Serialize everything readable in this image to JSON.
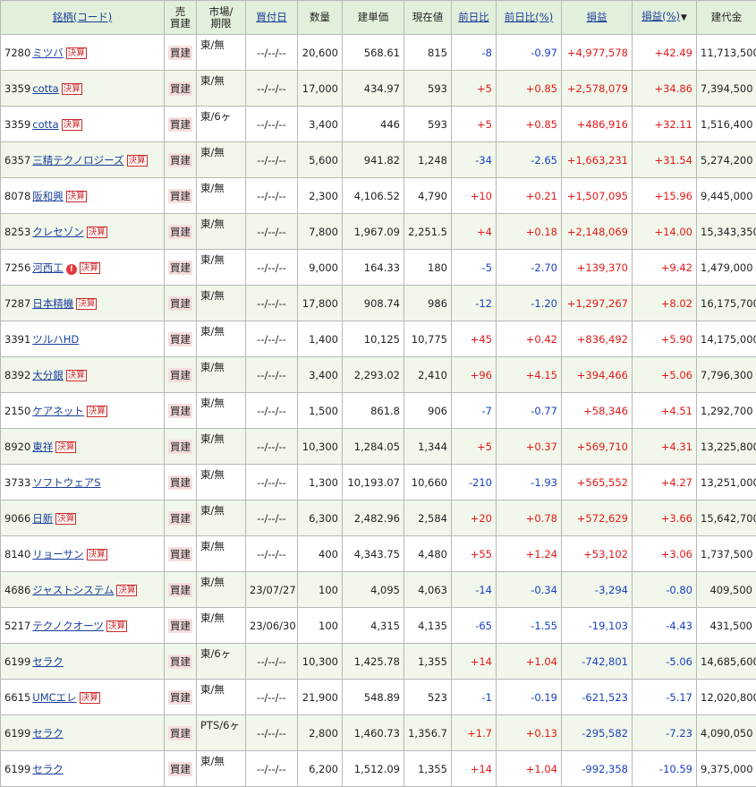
{
  "headers": {
    "name": "銘柄(コード)",
    "type": "売\n買建",
    "market": "市場/\n期限",
    "buy_date": "買付日",
    "quantity": "数量",
    "unit_price": "建単価",
    "current_price": "現在値",
    "day_change": "前日比",
    "day_change_pct": "前日比(%)",
    "pnl": "損益",
    "pnl_pct": "損益(%)",
    "sort_arrow": "▼",
    "position_value": "建代金"
  },
  "colors": {
    "positive": "#e41818",
    "negative": "#1a3fbf",
    "header_bg": "#e2efdb",
    "row_alt_bg": "#f1f7ea",
    "badge": "#cc2a2a"
  },
  "rows": [
    {
      "code": "7280",
      "name": "ミツバ",
      "badge": "決算",
      "alert": false,
      "type": "買建",
      "market": "東/無",
      "date": "--/--/--",
      "qty": "20,600",
      "price": "568.61",
      "current": "815",
      "change": "-8",
      "change_pct": "-0.97",
      "pnl": "+4,977,578",
      "pnl_pct": "+42.49",
      "value": "11,713,500"
    },
    {
      "code": "3359",
      "name": "cotta",
      "badge": "決算",
      "alert": false,
      "type": "買建",
      "market": "東/無",
      "date": "--/--/--",
      "qty": "17,000",
      "price": "434.97",
      "current": "593",
      "change": "+5",
      "change_pct": "+0.85",
      "pnl": "+2,578,079",
      "pnl_pct": "+34.86",
      "value": "7,394,500"
    },
    {
      "code": "3359",
      "name": "cotta",
      "badge": "決算",
      "alert": false,
      "type": "買建",
      "market": "東/6ヶ",
      "date": "--/--/--",
      "qty": "3,400",
      "price": "446",
      "current": "593",
      "change": "+5",
      "change_pct": "+0.85",
      "pnl": "+486,916",
      "pnl_pct": "+32.11",
      "value": "1,516,400"
    },
    {
      "code": "6357",
      "name": "三精テクノロジーズ",
      "badge": "決算",
      "alert": false,
      "type": "買建",
      "market": "東/無",
      "date": "--/--/--",
      "qty": "5,600",
      "price": "941.82",
      "current": "1,248",
      "change": "-34",
      "change_pct": "-2.65",
      "pnl": "+1,663,231",
      "pnl_pct": "+31.54",
      "value": "5,274,200"
    },
    {
      "code": "8078",
      "name": "阪和興",
      "badge": "決算",
      "alert": false,
      "type": "買建",
      "market": "東/無",
      "date": "--/--/--",
      "qty": "2,300",
      "price": "4,106.52",
      "current": "4,790",
      "change": "+10",
      "change_pct": "+0.21",
      "pnl": "+1,507,095",
      "pnl_pct": "+15.96",
      "value": "9,445,000"
    },
    {
      "code": "8253",
      "name": "クレセゾン",
      "badge": "決算",
      "alert": false,
      "type": "買建",
      "market": "東/無",
      "date": "--/--/--",
      "qty": "7,800",
      "price": "1,967.09",
      "current": "2,251.5",
      "change": "+4",
      "change_pct": "+0.18",
      "pnl": "+2,148,069",
      "pnl_pct": "+14.00",
      "value": "15,343,350"
    },
    {
      "code": "7256",
      "name": "河西工",
      "badge": "決算",
      "alert": true,
      "type": "買建",
      "market": "東/無",
      "date": "--/--/--",
      "qty": "9,000",
      "price": "164.33",
      "current": "180",
      "change": "-5",
      "change_pct": "-2.70",
      "pnl": "+139,370",
      "pnl_pct": "+9.42",
      "value": "1,479,000"
    },
    {
      "code": "7287",
      "name": "日本精機",
      "badge": "決算",
      "alert": false,
      "type": "買建",
      "market": "東/無",
      "date": "--/--/--",
      "qty": "17,800",
      "price": "908.74",
      "current": "986",
      "change": "-12",
      "change_pct": "-1.20",
      "pnl": "+1,297,267",
      "pnl_pct": "+8.02",
      "value": "16,175,700"
    },
    {
      "code": "3391",
      "name": "ツルハHD",
      "badge": "",
      "alert": false,
      "type": "買建",
      "market": "東/無",
      "date": "--/--/--",
      "qty": "1,400",
      "price": "10,125",
      "current": "10,775",
      "change": "+45",
      "change_pct": "+0.42",
      "pnl": "+836,492",
      "pnl_pct": "+5.90",
      "value": "14,175,000"
    },
    {
      "code": "8392",
      "name": "大分銀",
      "badge": "決算",
      "alert": false,
      "type": "買建",
      "market": "東/無",
      "date": "--/--/--",
      "qty": "3,400",
      "price": "2,293.02",
      "current": "2,410",
      "change": "+96",
      "change_pct": "+4.15",
      "pnl": "+394,466",
      "pnl_pct": "+5.06",
      "value": "7,796,300"
    },
    {
      "code": "2150",
      "name": "ケアネット",
      "badge": "決算",
      "alert": false,
      "type": "買建",
      "market": "東/無",
      "date": "--/--/--",
      "qty": "1,500",
      "price": "861.8",
      "current": "906",
      "change": "-7",
      "change_pct": "-0.77",
      "pnl": "+58,346",
      "pnl_pct": "+4.51",
      "value": "1,292,700"
    },
    {
      "code": "8920",
      "name": "東祥",
      "badge": "決算",
      "alert": false,
      "type": "買建",
      "market": "東/無",
      "date": "--/--/--",
      "qty": "10,300",
      "price": "1,284.05",
      "current": "1,344",
      "change": "+5",
      "change_pct": "+0.37",
      "pnl": "+569,710",
      "pnl_pct": "+4.31",
      "value": "13,225,800"
    },
    {
      "code": "3733",
      "name": "ソフトウェアS",
      "badge": "",
      "alert": false,
      "type": "買建",
      "market": "東/無",
      "date": "--/--/--",
      "qty": "1,300",
      "price": "10,193.07",
      "current": "10,660",
      "change": "-210",
      "change_pct": "-1.93",
      "pnl": "+565,552",
      "pnl_pct": "+4.27",
      "value": "13,251,000"
    },
    {
      "code": "9066",
      "name": "日新",
      "badge": "決算",
      "alert": false,
      "type": "買建",
      "market": "東/無",
      "date": "--/--/--",
      "qty": "6,300",
      "price": "2,482.96",
      "current": "2,584",
      "change": "+20",
      "change_pct": "+0.78",
      "pnl": "+572,629",
      "pnl_pct": "+3.66",
      "value": "15,642,700"
    },
    {
      "code": "8140",
      "name": "リョーサン",
      "badge": "決算",
      "alert": false,
      "type": "買建",
      "market": "東/無",
      "date": "--/--/--",
      "qty": "400",
      "price": "4,343.75",
      "current": "4,480",
      "change": "+55",
      "change_pct": "+1.24",
      "pnl": "+53,102",
      "pnl_pct": "+3.06",
      "value": "1,737,500"
    },
    {
      "code": "4686",
      "name": "ジャストシステム",
      "badge": "決算",
      "alert": false,
      "type": "買建",
      "market": "東/無",
      "date": "23/07/27",
      "qty": "100",
      "price": "4,095",
      "current": "4,063",
      "change": "-14",
      "change_pct": "-0.34",
      "pnl": "-3,294",
      "pnl_pct": "-0.80",
      "value": "409,500"
    },
    {
      "code": "5217",
      "name": "テクノクオーツ",
      "badge": "決算",
      "alert": false,
      "type": "買建",
      "market": "東/無",
      "date": "23/06/30",
      "qty": "100",
      "price": "4,315",
      "current": "4,135",
      "change": "-65",
      "change_pct": "-1.55",
      "pnl": "-19,103",
      "pnl_pct": "-4.43",
      "value": "431,500"
    },
    {
      "code": "6199",
      "name": "セラク",
      "badge": "",
      "alert": false,
      "type": "買建",
      "market": "東/6ヶ",
      "date": "--/--/--",
      "qty": "10,300",
      "price": "1,425.78",
      "current": "1,355",
      "change": "+14",
      "change_pct": "+1.04",
      "pnl": "-742,801",
      "pnl_pct": "-5.06",
      "value": "14,685,600"
    },
    {
      "code": "6615",
      "name": "UMCエレ",
      "badge": "決算",
      "alert": false,
      "type": "買建",
      "market": "東/無",
      "date": "--/--/--",
      "qty": "21,900",
      "price": "548.89",
      "current": "523",
      "change": "-1",
      "change_pct": "-0.19",
      "pnl": "-621,523",
      "pnl_pct": "-5.17",
      "value": "12,020,800"
    },
    {
      "code": "6199",
      "name": "セラク",
      "badge": "",
      "alert": false,
      "type": "買建",
      "market": "PTS/6ヶ",
      "date": "--/--/--",
      "qty": "2,800",
      "price": "1,460.73",
      "current": "1,356.7",
      "change": "+1.7",
      "change_pct": "+0.13",
      "pnl": "-295,582",
      "pnl_pct": "-7.23",
      "value": "4,090,050"
    },
    {
      "code": "6199",
      "name": "セラク",
      "badge": "",
      "alert": false,
      "type": "買建",
      "market": "東/無",
      "date": "--/--/--",
      "qty": "6,200",
      "price": "1,512.09",
      "current": "1,355",
      "change": "+14",
      "change_pct": "+1.04",
      "pnl": "-992,358",
      "pnl_pct": "-10.59",
      "value": "9,375,000"
    }
  ]
}
